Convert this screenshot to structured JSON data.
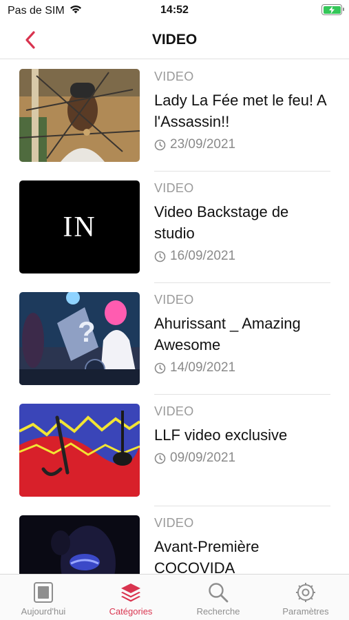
{
  "status_bar": {
    "carrier": "Pas de SIM",
    "time": "14:52"
  },
  "nav": {
    "title": "VIDEO"
  },
  "items": [
    {
      "category": "VIDEO",
      "title": "Lady La Fée met le feu! A l'Assassin!!",
      "date": "23/09/2021",
      "thumb_icon": "portrait-photo"
    },
    {
      "category": "VIDEO",
      "title": "Video Backstage de studio",
      "date": "16/09/2021",
      "thumb_text": "IN"
    },
    {
      "category": "VIDEO",
      "title": "Ahurissant _ Amazing Awesome",
      "date": "14/09/2021",
      "thumb_icon": "concert-photo"
    },
    {
      "category": "VIDEO",
      "title": "LLF video exclusive",
      "date": "09/09/2021",
      "thumb_icon": "abstract-art"
    },
    {
      "category": "VIDEO",
      "title": "Avant-Première COCOVIDA",
      "date": "",
      "thumb_icon": "dark-portrait"
    }
  ],
  "tabs": [
    {
      "label": "Aujourd'hui",
      "icon": "newspaper-icon"
    },
    {
      "label": "Catégories",
      "icon": "layers-icon"
    },
    {
      "label": "Recherche",
      "icon": "search-icon"
    },
    {
      "label": "Paramètres",
      "icon": "gear-icon"
    }
  ],
  "colors": {
    "accent": "#d9344f",
    "battery": "#34c759",
    "secondary_text": "#9a9a9a"
  }
}
